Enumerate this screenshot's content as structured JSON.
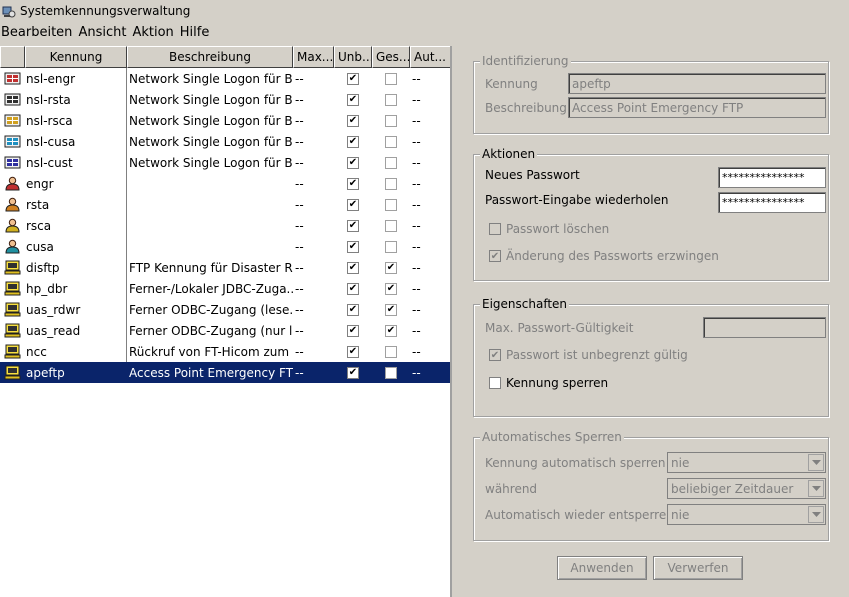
{
  "window": {
    "title": "Systemkennungsverwaltung"
  },
  "menu": [
    "Bearbeiten",
    "Ansicht",
    "Aktion",
    "Hilfe"
  ],
  "table": {
    "headers": [
      "Kennung",
      "Beschreibung",
      "Max...",
      "Unb...",
      "Ges...",
      "Aut..."
    ],
    "rows": [
      {
        "icon": "keyboard-user-icon",
        "kennung": "nsl-engr",
        "beschreibung": "Network Single Logon für B...",
        "max": "--",
        "unb": true,
        "ges": false,
        "aut": "--"
      },
      {
        "icon": "keyboard-user-icon",
        "kennung": "nsl-rsta",
        "beschreibung": "Network Single Logon für B...",
        "max": "--",
        "unb": true,
        "ges": false,
        "aut": "--"
      },
      {
        "icon": "keyboard-user-icon",
        "kennung": "nsl-rsca",
        "beschreibung": "Network Single Logon für B...",
        "max": "--",
        "unb": true,
        "ges": false,
        "aut": "--"
      },
      {
        "icon": "keyboard-user-icon",
        "kennung": "nsl-cusa",
        "beschreibung": "Network Single Logon für B...",
        "max": "--",
        "unb": true,
        "ges": false,
        "aut": "--"
      },
      {
        "icon": "keyboard-user-icon",
        "kennung": "nsl-cust",
        "beschreibung": "Network Single Logon für B...",
        "max": "--",
        "unb": true,
        "ges": false,
        "aut": "--"
      },
      {
        "icon": "user-icon",
        "kennung": "engr",
        "beschreibung": "",
        "max": "--",
        "unb": true,
        "ges": false,
        "aut": "--"
      },
      {
        "icon": "user-icon",
        "kennung": "rsta",
        "beschreibung": "",
        "max": "--",
        "unb": true,
        "ges": false,
        "aut": "--"
      },
      {
        "icon": "user-icon",
        "kennung": "rsca",
        "beschreibung": "",
        "max": "--",
        "unb": true,
        "ges": false,
        "aut": "--"
      },
      {
        "icon": "user-icon",
        "kennung": "cusa",
        "beschreibung": "",
        "max": "--",
        "unb": true,
        "ges": false,
        "aut": "--"
      },
      {
        "icon": "terminal-user-icon",
        "kennung": "disftp",
        "beschreibung": "FTP Kennung für Disaster R...",
        "max": "--",
        "unb": true,
        "ges": true,
        "aut": "--"
      },
      {
        "icon": "terminal-user-icon",
        "kennung": "hp_dbr",
        "beschreibung": "Ferner-/Lokaler JDBC-Zuga...",
        "max": "--",
        "unb": true,
        "ges": true,
        "aut": "--"
      },
      {
        "icon": "terminal-user-icon",
        "kennung": "uas_rdwr",
        "beschreibung": "Ferner ODBC-Zugang (lese...",
        "max": "--",
        "unb": true,
        "ges": true,
        "aut": "--"
      },
      {
        "icon": "terminal-user-icon",
        "kennung": "uas_read",
        "beschreibung": "Ferner ODBC-Zugang (nur l...",
        "max": "--",
        "unb": true,
        "ges": true,
        "aut": "--"
      },
      {
        "icon": "terminal-user-icon",
        "kennung": "ncc",
        "beschreibung": "Rückruf von FT-Hicom zum ...",
        "max": "--",
        "unb": true,
        "ges": false,
        "aut": "--"
      },
      {
        "icon": "terminal-user-icon",
        "kennung": "apeftp",
        "beschreibung": "Access Point Emergency FTP",
        "max": "--",
        "unb": true,
        "ges": false,
        "aut": "--",
        "selected": true
      }
    ]
  },
  "identifizierung": {
    "title": "Identifizierung",
    "kennung_label": "Kennung",
    "kennung_value": "apeftp",
    "beschreibung_label": "Beschreibung",
    "beschreibung_value": "Access Point Emergency FTP"
  },
  "aktionen": {
    "title": "Aktionen",
    "neues_passwort_label": "Neues Passwort",
    "neues_passwort_value": "***************",
    "wiederholen_label": "Passwort-Eingabe wiederholen",
    "wiederholen_value": "***************",
    "loeschen_label": "Passwort löschen",
    "loeschen_checked": false,
    "erzwingen_label": "Änderung des Passworts erzwingen",
    "erzwingen_checked": true
  },
  "eigenschaften": {
    "title": "Eigenschaften",
    "max_label": "Max. Passwort-Gültigkeit",
    "max_value": "",
    "unbegrenzt_label": "Passwort ist unbegrenzt gültig",
    "unbegrenzt_checked": true,
    "sperren_label": "Kennung sperren",
    "sperren_checked": false
  },
  "auto_sperren": {
    "title": "Automatisches Sperren",
    "auto_label": "Kennung automatisch sperren",
    "auto_value": "nie",
    "waehrend_label": "während",
    "waehrend_value": "beliebiger Zeitdauer",
    "entsperren_label": "Automatisch wieder entsperren",
    "entsperren_value": "nie"
  },
  "buttons": {
    "anwenden": "Anwenden",
    "verwerfen": "Verwerfen"
  },
  "colors": {
    "selection": "#0a246a",
    "panel": "#d4d0c8",
    "disabled_text": "#808080"
  }
}
